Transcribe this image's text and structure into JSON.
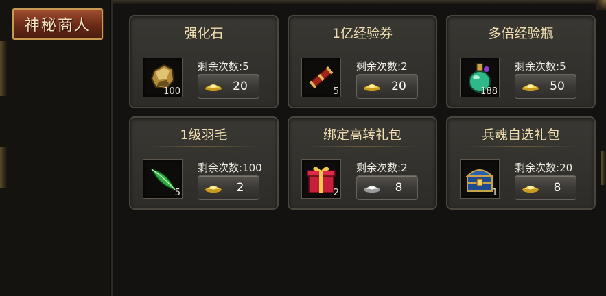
{
  "sidebar": {
    "tab_label": "神秘商人"
  },
  "shop": {
    "items": [
      {
        "name": "强化石",
        "remain_label": "剩余次数:",
        "remain": "5",
        "count": "100",
        "price": "20",
        "currency": "gold-ingot-icon",
        "icon": "stone-icon"
      },
      {
        "name": "1亿经验券",
        "remain_label": "剩余次数:",
        "remain": "2",
        "count": "5",
        "price": "20",
        "currency": "gold-ingot-icon",
        "icon": "scroll-icon"
      },
      {
        "name": "多倍经验瓶",
        "remain_label": "剩余次数:",
        "remain": "5",
        "count": "188",
        "price": "50",
        "currency": "gold-ingot-icon",
        "icon": "potion-icon"
      },
      {
        "name": "1级羽毛",
        "remain_label": "剩余次数:",
        "remain": "100",
        "count": "5",
        "price": "2",
        "currency": "gold-ingot-icon",
        "icon": "feather-icon"
      },
      {
        "name": "绑定高转礼包",
        "remain_label": "剩余次数:",
        "remain": "2",
        "count": "2",
        "price": "8",
        "currency": "silver-ingot-icon",
        "icon": "gift-box-icon"
      },
      {
        "name": "兵魂自选礼包",
        "remain_label": "剩余次数:",
        "remain": "20",
        "count": "1",
        "price": "8",
        "currency": "gold-ingot-icon",
        "icon": "treasure-chest-icon"
      }
    ]
  }
}
